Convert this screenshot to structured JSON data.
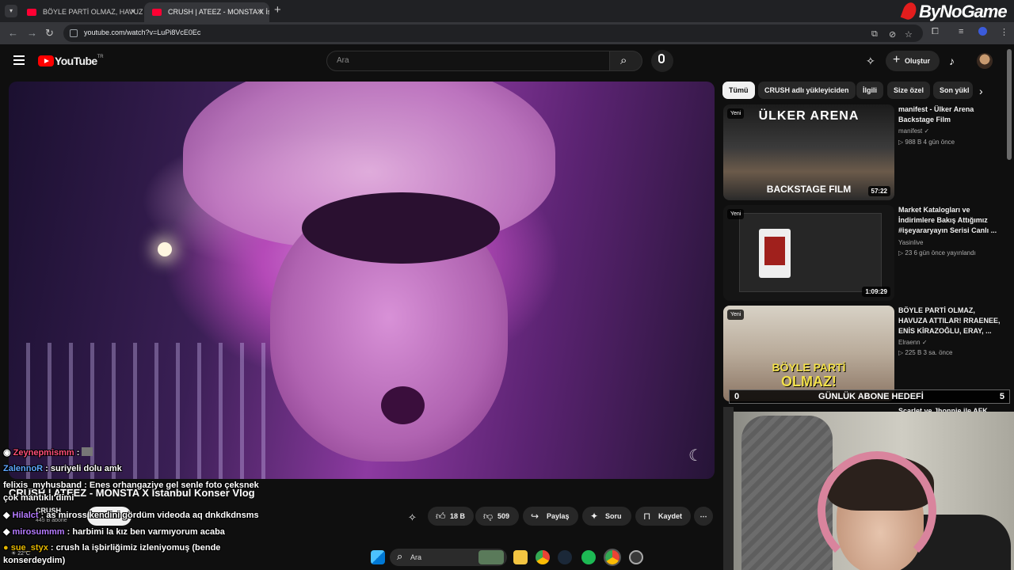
{
  "browser": {
    "tabs": [
      {
        "title": "BÖYLE PARTİ OLMAZ, HAVUZA"
      },
      {
        "title": "CRUSH | ATEEZ - MONSTA X İst"
      }
    ],
    "url": "youtube.com/watch?v=LuPi8VcE0Ec",
    "brand_watermark": "ByNoGame"
  },
  "youtube": {
    "logo_text": "YouTube",
    "logo_region": "TR",
    "search_placeholder": "Ara",
    "create_label": "Oluştur"
  },
  "video": {
    "title": "CRUSH | ATEEZ - MONSTA X İstanbul Konser Vlog",
    "channel": "CRUSH",
    "subscribers": "445 B abone",
    "subscribe_label": "Kendini",
    "likes": "18 B",
    "dislikes": "509",
    "share_label": "Paylaş",
    "ask_label": "Soru",
    "save_label": "Kaydet"
  },
  "chat": [
    {
      "user": "Zeynepmismm",
      "msg": ""
    },
    {
      "user": "ZalennoR",
      "msg": "suriyeli dolu amk"
    },
    {
      "user": "felixis_myhusband",
      "msg": "Enes orhangaziye gel senle foto çeksnek"
    },
    {
      "user": "",
      "msg": "çok mantıklı dimi"
    },
    {
      "user": "Hilalct",
      "msg": "as miross kendini gördüm videoda aq dnkdkdnsms"
    },
    {
      "user": "mirosummm",
      "msg": "harbimi la kız ben varmıyorum acaba"
    },
    {
      "user": "sue_styx",
      "msg": "crush la işbirliğimiz izleniyomuş (bende"
    },
    {
      "user": "",
      "msg": "konserdeydim)"
    }
  ],
  "sidebar": {
    "chips": [
      "Tümü",
      "CRUSH adlı yükleyiciden",
      "İlgili",
      "Size özel",
      "Son yükl"
    ],
    "recommended": [
      {
        "thumb_text": "ÜLKER ARENA",
        "thumb_text2": "BACKSTAGE FILM",
        "badge": "Yeni",
        "duration": "57:22",
        "title": "manifest - Ülker Arena Backstage Film",
        "channel": "manifest",
        "meta": "988 B   4 gün önce"
      },
      {
        "badge": "Yeni",
        "duration": "1:09:29",
        "title": "Market Katalogları ve İndirimlere Bakış Attığımız #işeyararyayın Serisi Canlı ...",
        "channel": "Yasinlive",
        "meta": "23   6 gün önce yayınlandı"
      },
      {
        "thumb_text": "BÖYLE PARTİ",
        "thumb_text2": "OLMAZ!",
        "badge": "Yeni",
        "title": "BÖYLE PARTİ OLMAZ, HAVUZA ATTILAR! RRAENEE, ENİS KİRAZOĞLU, ERAY, ...",
        "channel": "Elraenn",
        "meta": "225 B   3 sa. önce"
      },
      {
        "title": "Scarlet ve Jhonnie ile AFK"
      }
    ]
  },
  "overlay": {
    "goal_start": "0",
    "goal_label": "GÜNLÜK ABONE HEDEFİ",
    "goal_end": "5"
  },
  "taskbar": {
    "search_label": "Ara",
    "weather": "22°C"
  }
}
